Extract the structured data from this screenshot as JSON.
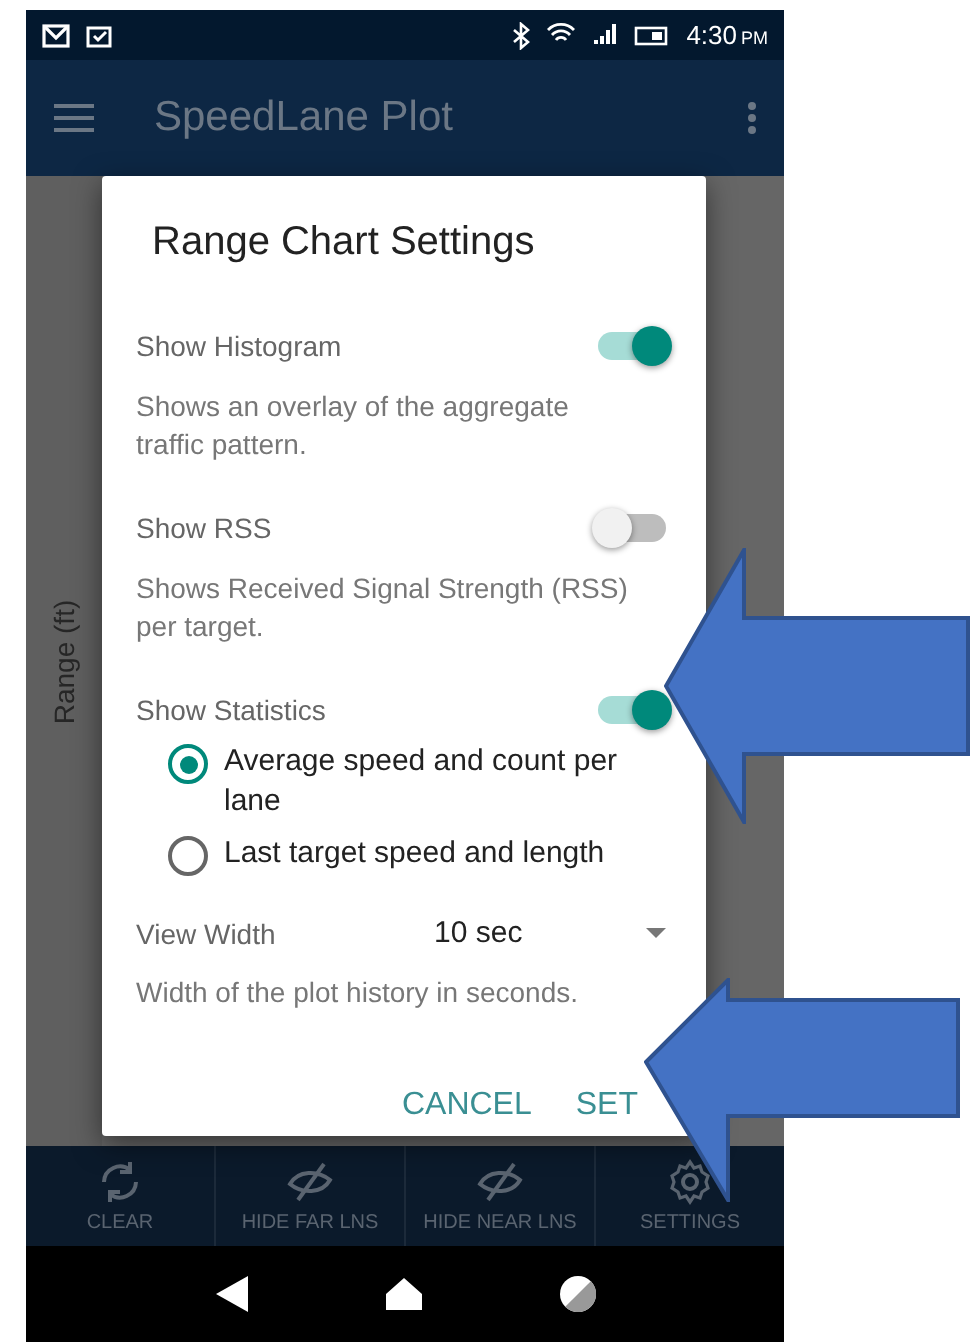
{
  "status_bar": {
    "time": "4:30",
    "time_suffix": "PM"
  },
  "app_bar": {
    "title": "SpeedLane Plot"
  },
  "chart": {
    "y_axis_label": "Range (ft)"
  },
  "dialog": {
    "title": "Range Chart Settings",
    "toggles": [
      {
        "label": "Show Histogram",
        "on": true,
        "description": "Shows an overlay of the aggregate traffic pattern."
      },
      {
        "label": "Show RSS",
        "on": false,
        "description": "Shows Received Signal Strength (RSS) per target."
      },
      {
        "label": "Show Statistics",
        "on": true,
        "options": [
          {
            "label": "Average speed and count per lane",
            "selected": true
          },
          {
            "label": "Last target speed and length",
            "selected": false
          }
        ]
      }
    ],
    "view_width": {
      "label": "View Width",
      "value": "10 sec",
      "description": "Width of the plot history in seconds."
    },
    "buttons": [
      "CANCEL",
      "SET"
    ]
  },
  "toolbar": [
    {
      "kind": "refresh",
      "label": "CLEAR"
    },
    {
      "kind": "eye_off",
      "label": "HIDE FAR LNS"
    },
    {
      "kind": "eye_off",
      "label": "HIDE NEAR LNS"
    },
    {
      "kind": "settings",
      "label": "SETTINGS"
    }
  ]
}
